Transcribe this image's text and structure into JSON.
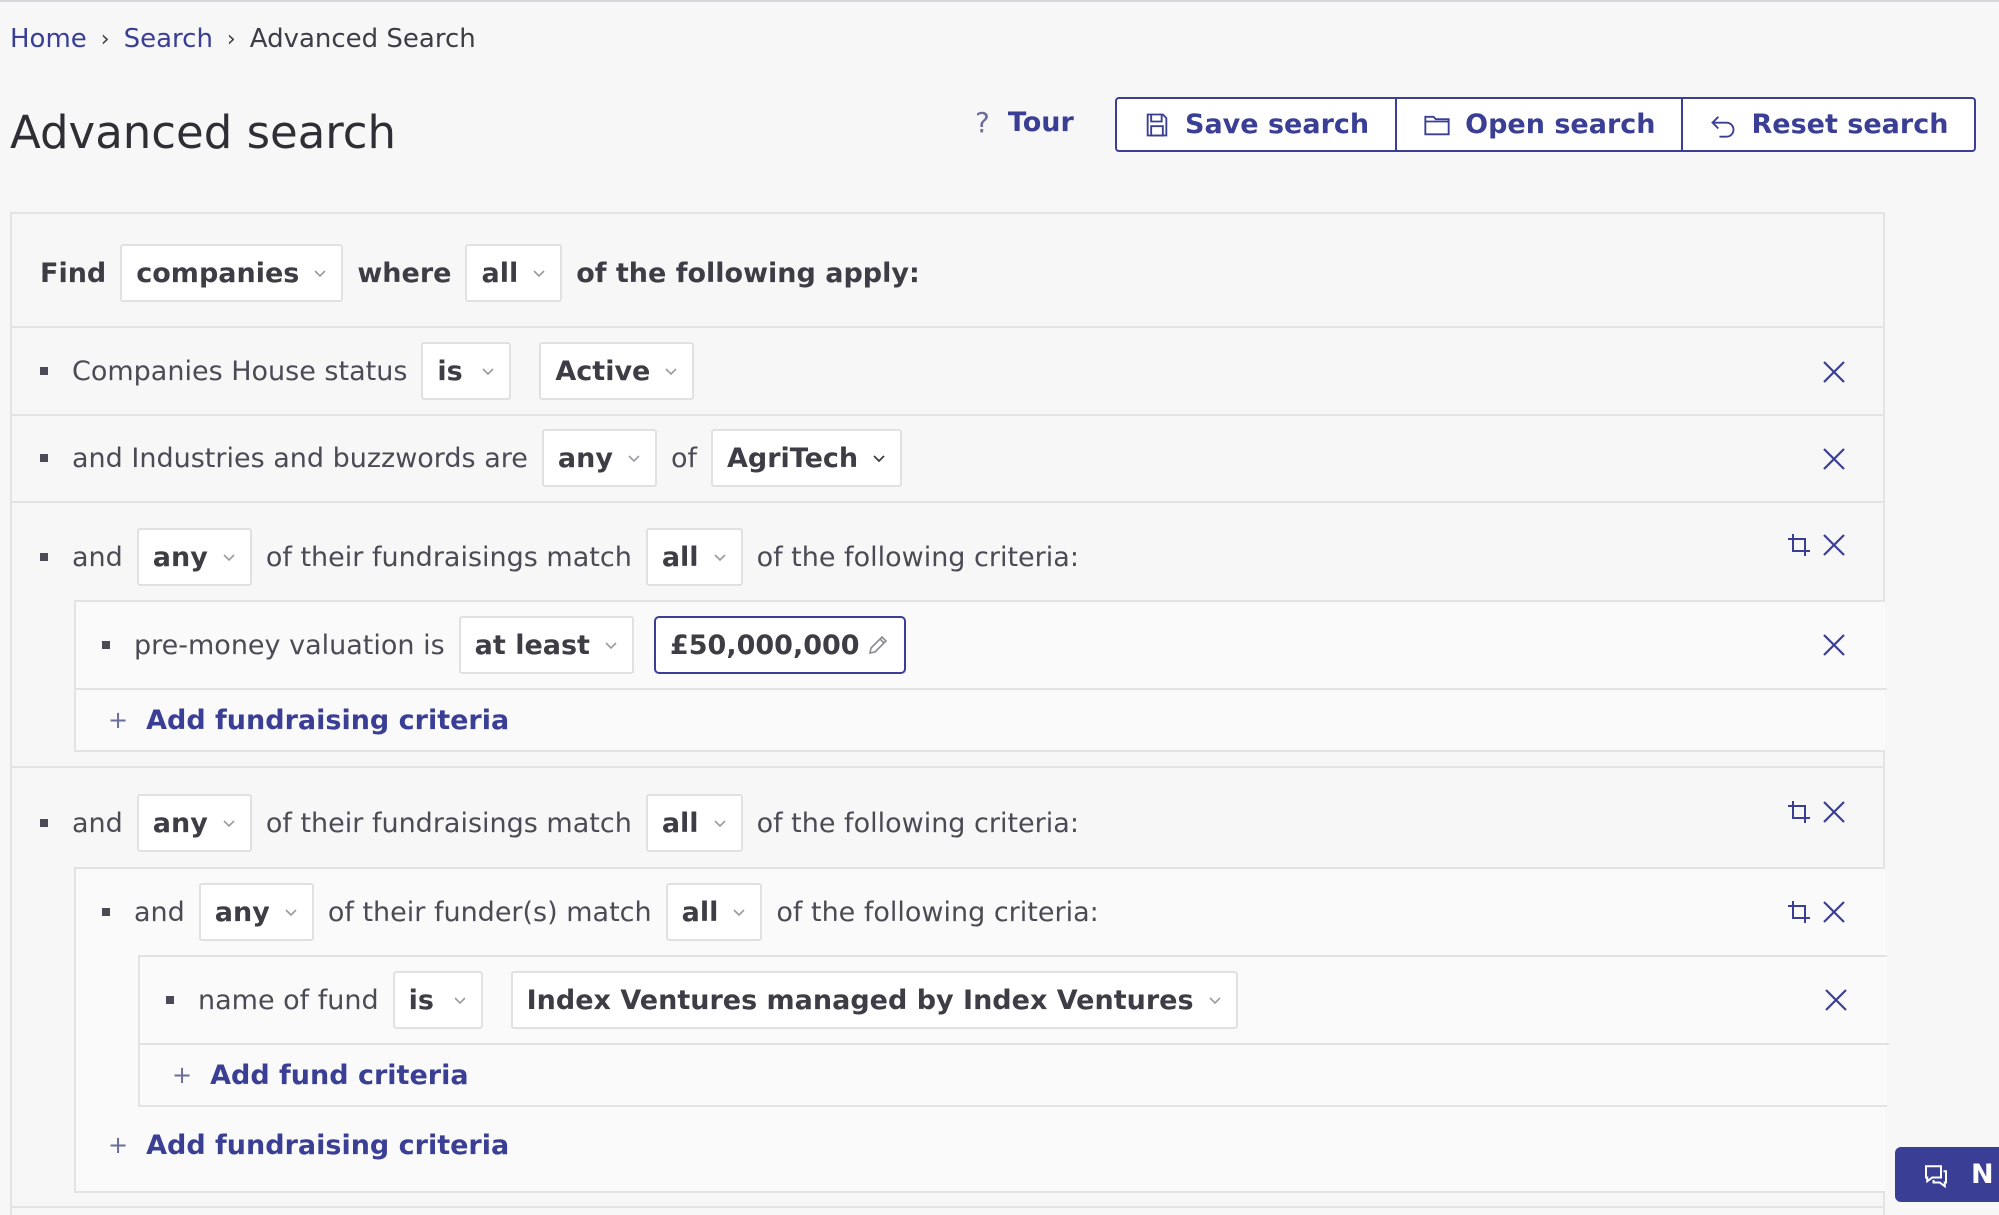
{
  "breadcrumb": {
    "home": "Home",
    "search": "Search",
    "current": "Advanced Search"
  },
  "page_title": "Advanced search",
  "toolbar": {
    "tour": "Tour",
    "save": "Save search",
    "open": "Open search",
    "reset": "Reset search"
  },
  "find_row": {
    "find": "Find",
    "entity": "companies",
    "where": "where",
    "quantifier": "all",
    "suffix": "of the following apply:"
  },
  "criteria": {
    "status": {
      "label": "Companies House status",
      "op": "is",
      "value": "Active"
    },
    "industries": {
      "label": "and Industries and buzzwords are",
      "op": "any",
      "of": "of",
      "value": "AgriTech"
    },
    "group1": {
      "and": "and",
      "quant": "any",
      "text1": "of their fundraisings match",
      "quant2": "all",
      "text2": "of the following criteria:",
      "sub": {
        "label": "pre-money valuation is",
        "op": "at least",
        "value": "£50,000,000"
      },
      "add": "Add fundraising criteria"
    },
    "group2": {
      "and": "and",
      "quant": "any",
      "text1": "of their fundraisings match",
      "quant2": "all",
      "text2": "of the following criteria:",
      "funder": {
        "and": "and",
        "quant": "any",
        "text1": "of their funder(s) match",
        "quant2": "all",
        "text2": "of the following criteria:",
        "fund": {
          "label": "name of fund",
          "op": "is",
          "value": "Index Ventures managed by Index Ventures"
        },
        "add": "Add fund criteria"
      },
      "add": "Add fundraising criteria"
    }
  },
  "chat": {
    "label": "N"
  },
  "colors": {
    "accent": "#3a3f95",
    "background": "#f7f7f7",
    "border": "#e3e3e6"
  },
  "icons": [
    "chevron-right-icon",
    "question-icon",
    "save-icon",
    "folder-icon",
    "reset-icon",
    "chevron-down-icon",
    "close-icon",
    "nest-icon",
    "plus-icon",
    "pencil-icon",
    "chat-icon"
  ]
}
